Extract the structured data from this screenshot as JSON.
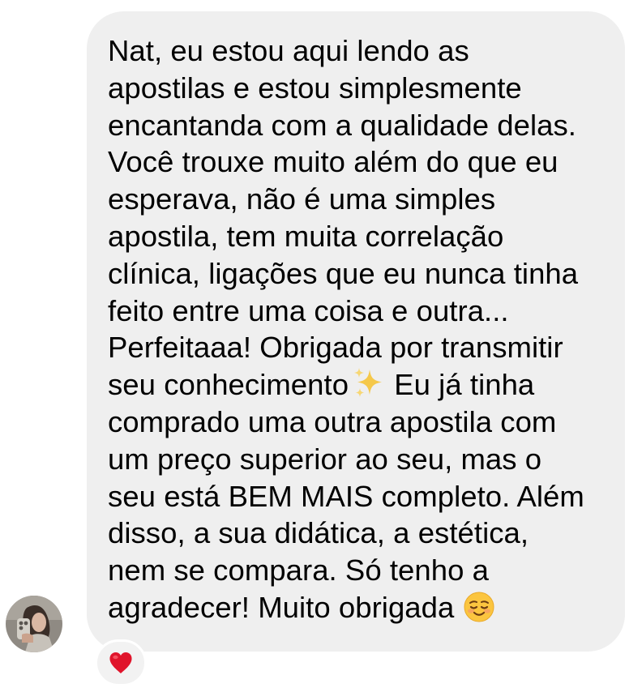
{
  "message": {
    "lines": [
      "Nat, eu estou aqui lendo as",
      "apostilas e estou simplesmente",
      "encantanda com a qualidade delas.",
      "Você trouxe muito além do que eu",
      "esperava, não é uma simples",
      "apostila, tem muita correlação",
      "clínica, ligações que eu nunca tinha",
      "feito entre uma coisa e outra...",
      "Perfeitaaa! Obrigada por transmitir"
    ],
    "line_10_before_emoji": "seu conhecimento",
    "line_10_after_emoji": "Eu já tinha",
    "lines_after": [
      "comprado uma outra apostila com",
      "um preço superior ao seu, mas o",
      "seu está BEM MAIS completo. Além",
      "disso, a sua didática, a estética,",
      "nem se compara. Só tenho a"
    ],
    "last_line": "agradecer! Muito obrigada",
    "sparkles_emoji": "sparkles-icon",
    "smiling_emoji": "smiling-face-icon"
  },
  "reaction": {
    "icon": "red-heart-icon",
    "color": "#e0142b"
  },
  "bubble_color": "#efefef"
}
